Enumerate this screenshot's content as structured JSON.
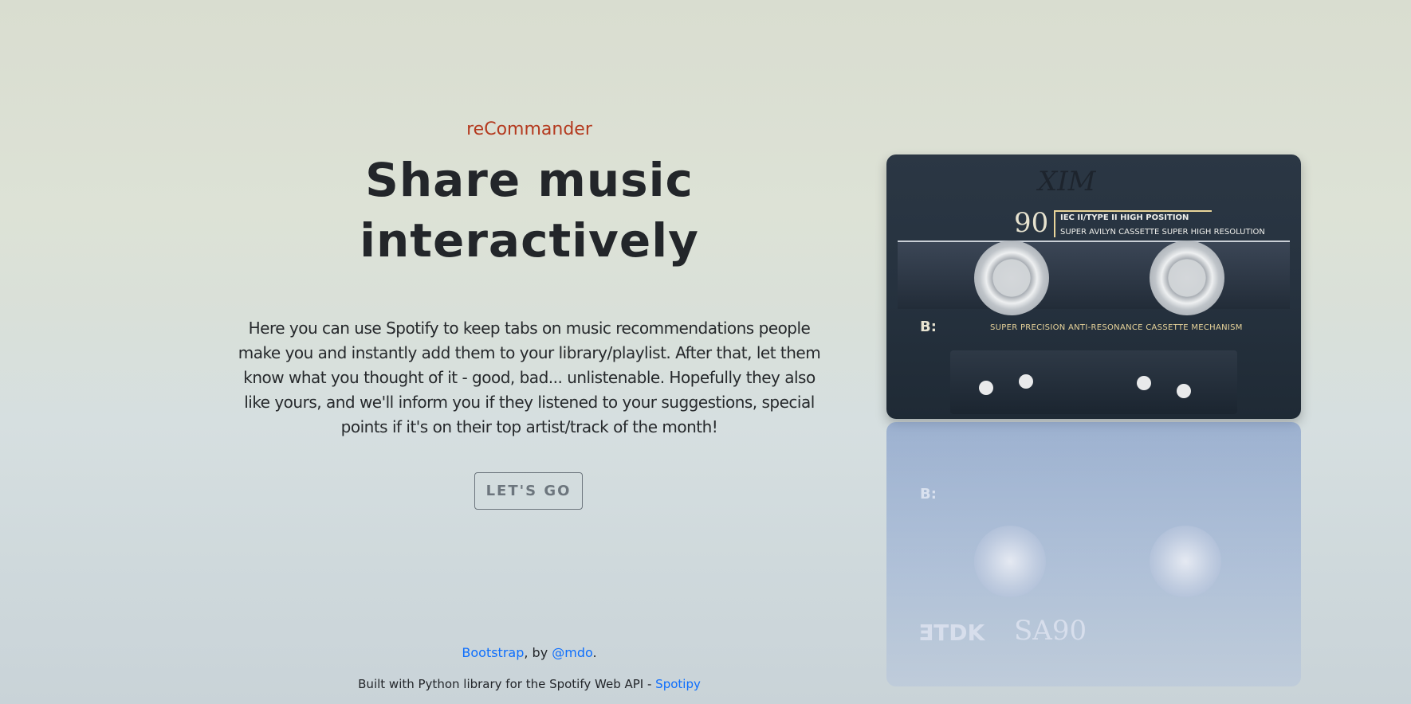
{
  "brand": "reCommander",
  "hero": {
    "title_line1": "Share music",
    "title_line2": "interactively",
    "lead": "Here you can use Spotify to keep tabs on music recommendations people make you and instantly add them to your library/playlist. After that, let them know what you thought of it - good, bad... unlistenable. Hopefully they also like yours, and we'll inform you if they listened to your suggestions, special points if it's on their top artist/track of the month!",
    "cta_label": "LET'S GO"
  },
  "footer": {
    "bootstrap_link": "Bootstrap",
    "by_text": ", by ",
    "mdo_link": "@mdo",
    "period": ".",
    "built_text": "Built with Python library for the Spotify Web API - ",
    "spotipy_link": "Spotipy"
  },
  "cassette": {
    "handwritten": "XIM",
    "number": "90",
    "type_label": "IEC II/TYPE II  HIGH POSITION",
    "sub_label": "SUPER AVILYN CASSETTE SUPER HIGH RESOLUTION",
    "side": "B:",
    "mechanism": "SUPER PRECISION ANTI-RESONANCE CASSETTE MECHANISM",
    "reflection_brand": "ƎTDK",
    "reflection_model": "SA90"
  },
  "colors": {
    "brand": "#b4391e",
    "link": "#0d6efd",
    "button_border": "#6c757d"
  }
}
